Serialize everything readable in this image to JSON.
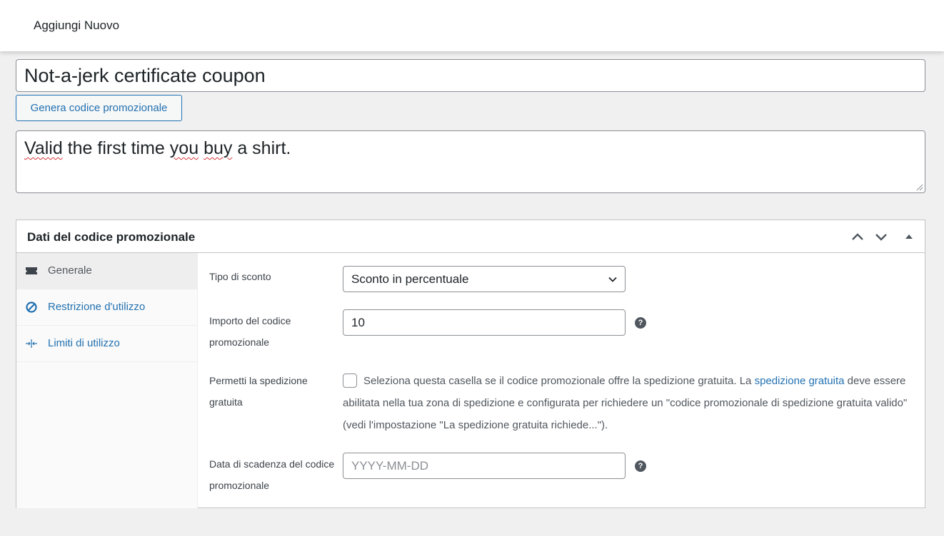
{
  "topbar": {
    "title": "Aggiungi Nuovo"
  },
  "coupon": {
    "title_value": "Not-a-jerk certificate coupon",
    "generate_button": "Genera codice promozionale",
    "description_pre": "Valid",
    "description_mid1": " the first time ",
    "description_typo2": "you",
    "description_mid2": " ",
    "description_typo3": "buy",
    "description_post": " a shirt."
  },
  "panel": {
    "title": "Dati del codice promozionale",
    "tabs": [
      {
        "label": "Generale",
        "icon": "ticket-icon"
      },
      {
        "label": "Restrizione d'utilizzo",
        "icon": "block-icon"
      },
      {
        "label": "Limiti di utilizzo",
        "icon": "limits-icon"
      }
    ],
    "fields": {
      "discount_type_label": "Tipo di sconto",
      "discount_type_value": "Sconto in percentuale",
      "amount_label_1": "Importo del codice",
      "amount_label_2": "promozionale",
      "amount_value": "10",
      "free_shipping_label_1": "Permetti la spedizione",
      "free_shipping_label_2": "gratuita",
      "free_shipping_desc_pre": "Seleziona questa casella se il codice promozionale offre la spedizione gratuita. La ",
      "free_shipping_link": "spedizione gratuita",
      "free_shipping_desc_post": " deve essere abilitata nella tua zona di spedizione e configurata per richiedere un \"codice promozionale di spedizione gratuita valido\" (vedi l'impostazione \"La spedizione gratuita richiede...\").",
      "expiry_label_1": "Data di scadenza del codice",
      "expiry_label_2": "promozionale",
      "expiry_placeholder": "YYYY-MM-DD",
      "help_glyph": "?"
    }
  }
}
